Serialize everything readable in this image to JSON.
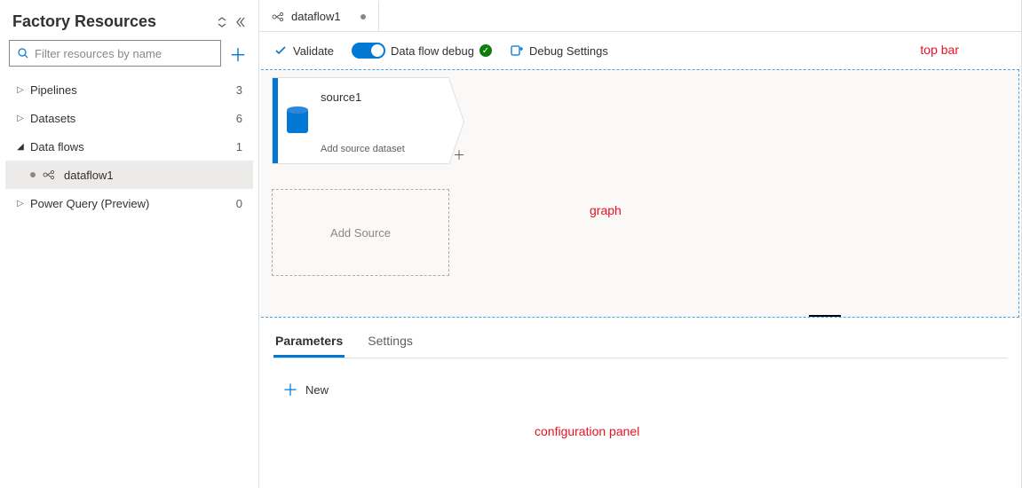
{
  "sidebar": {
    "title": "Factory Resources",
    "filter_placeholder": "Filter resources by name",
    "items": [
      {
        "label": "Pipelines",
        "count": "3",
        "expanded": false
      },
      {
        "label": "Datasets",
        "count": "6",
        "expanded": false
      },
      {
        "label": "Data flows",
        "count": "1",
        "expanded": true,
        "children": [
          {
            "label": "dataflow1",
            "selected": true
          }
        ]
      },
      {
        "label": "Power Query (Preview)",
        "count": "0",
        "expanded": false
      }
    ]
  },
  "tab": {
    "label": "dataflow1"
  },
  "toolbar": {
    "validate": "Validate",
    "debug_label": "Data flow debug",
    "debug_settings": "Debug Settings"
  },
  "annotations": {
    "top_bar": "top bar",
    "graph": "graph",
    "config_panel": "configuration panel"
  },
  "graph": {
    "source_node": {
      "name": "source1",
      "subtitle": "Add source dataset"
    },
    "add_source": "Add Source"
  },
  "config": {
    "tabs": [
      {
        "label": "Parameters",
        "active": true
      },
      {
        "label": "Settings",
        "active": false
      }
    ],
    "new_label": "New"
  }
}
